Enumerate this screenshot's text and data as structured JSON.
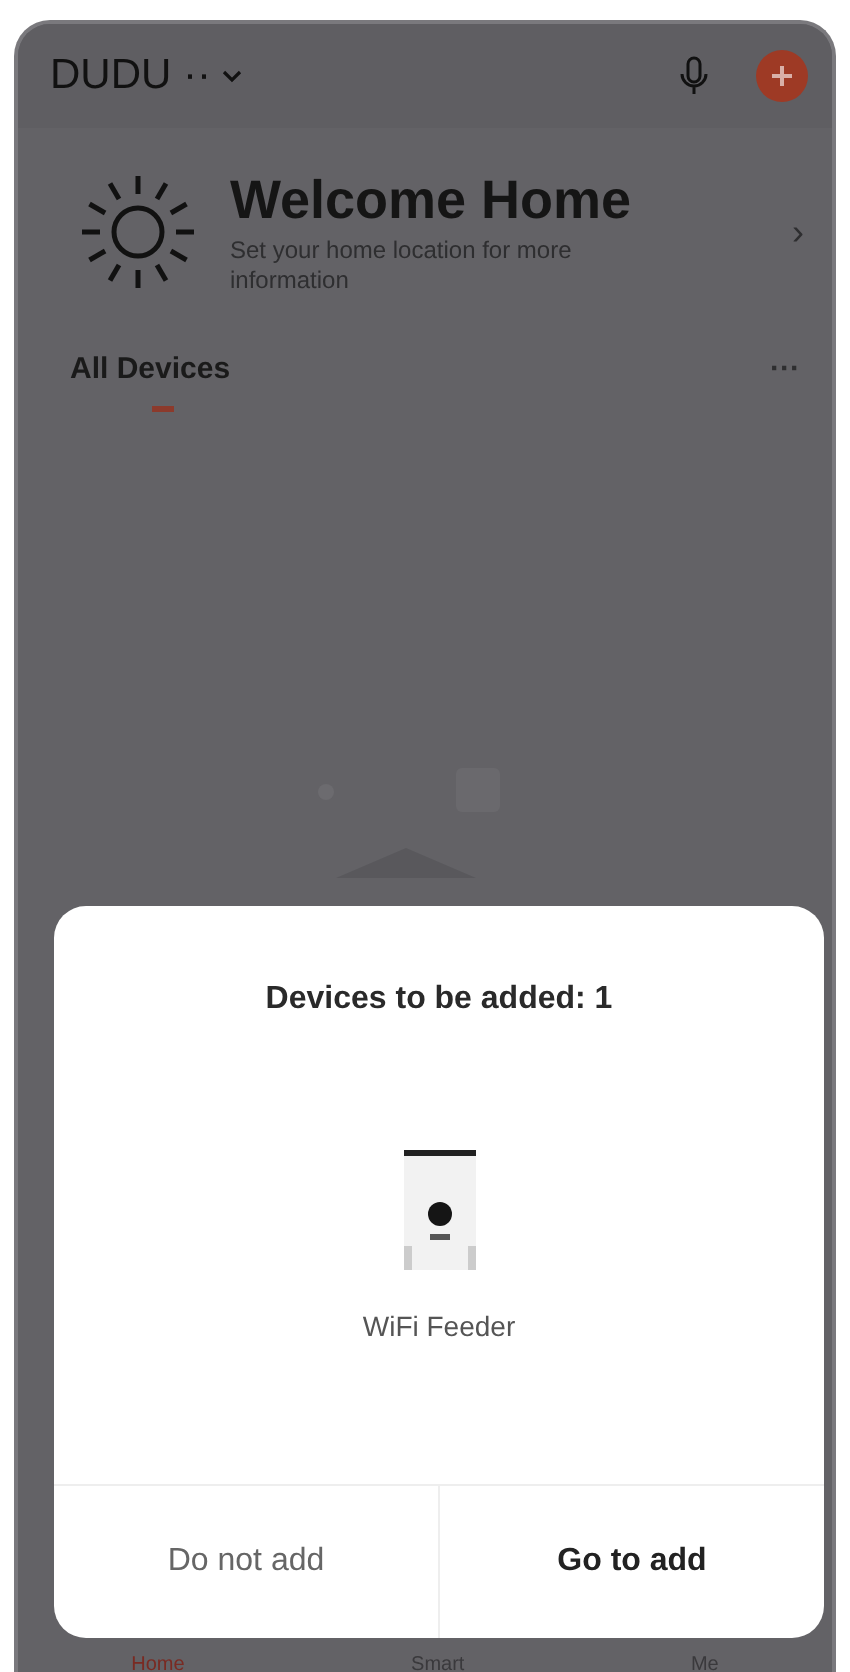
{
  "header": {
    "home_name": "DUDU ··"
  },
  "welcome": {
    "title": "Welcome Home",
    "subtitle": "Set your home location for more information",
    "chevron": "›"
  },
  "section": {
    "title": "All Devices",
    "more": "···"
  },
  "dialog": {
    "title": "Devices to be added: 1",
    "device": {
      "name": "WiFi Feeder",
      "kind": "picture"
    },
    "buttons": [
      {
        "label": "Do not add",
        "primary": false
      },
      {
        "label": "Go to add",
        "primary": true
      }
    ]
  },
  "tabs": [
    {
      "label": "Home",
      "selected": true
    },
    {
      "label": "Smart",
      "selected": false
    },
    {
      "label": "Me",
      "selected": false
    }
  ]
}
